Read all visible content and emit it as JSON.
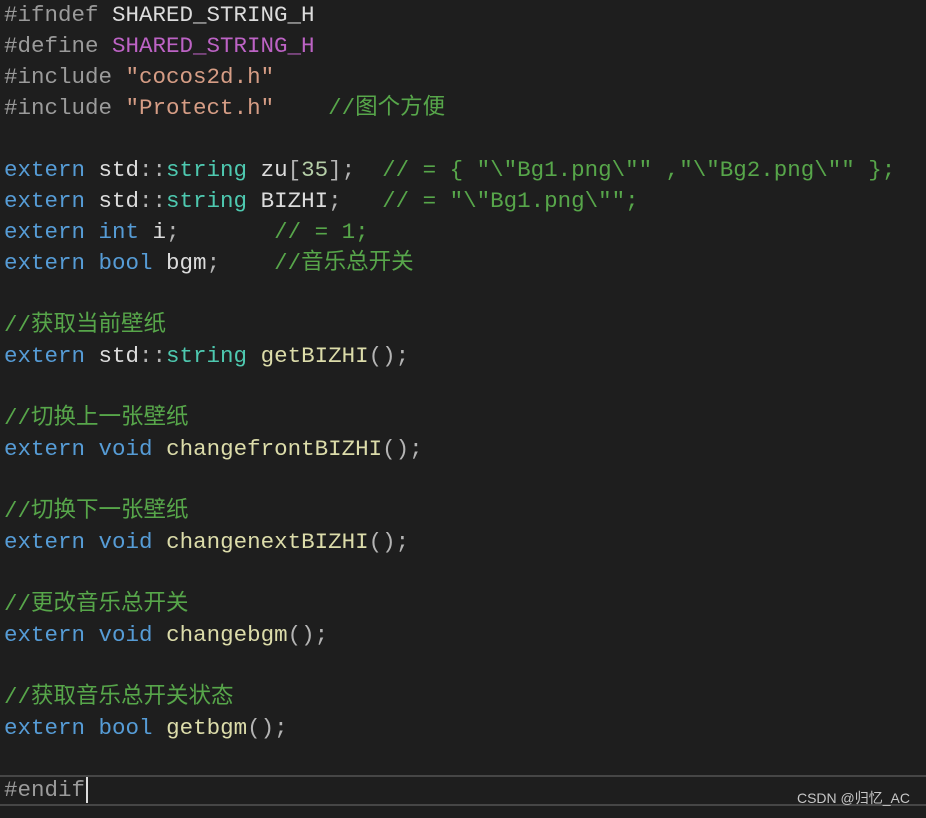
{
  "editor": {
    "lines": [
      [
        {
          "t": "#ifndef",
          "c": "prep"
        },
        {
          "t": " ",
          "c": "ident"
        },
        {
          "t": "SHARED_STRING_H",
          "c": "macro-plain"
        }
      ],
      [
        {
          "t": "#define",
          "c": "prep"
        },
        {
          "t": " ",
          "c": "ident"
        },
        {
          "t": "SHARED_STRING_H",
          "c": "macro"
        }
      ],
      [
        {
          "t": "#include",
          "c": "prep"
        },
        {
          "t": " ",
          "c": "ident"
        },
        {
          "t": "\"cocos2d.h\"",
          "c": "str"
        }
      ],
      [
        {
          "t": "#include",
          "c": "prep"
        },
        {
          "t": " ",
          "c": "ident"
        },
        {
          "t": "\"Protect.h\"",
          "c": "str"
        },
        {
          "t": "    ",
          "c": "ident"
        },
        {
          "t": "//图个方便",
          "c": "com"
        }
      ],
      [],
      [
        {
          "t": "extern",
          "c": "kw"
        },
        {
          "t": " std",
          "c": "ns"
        },
        {
          "t": "::",
          "c": "punc"
        },
        {
          "t": "string",
          "c": "type"
        },
        {
          "t": " zu",
          "c": "ident"
        },
        {
          "t": "[",
          "c": "punc"
        },
        {
          "t": "35",
          "c": "num"
        },
        {
          "t": "];",
          "c": "punc"
        },
        {
          "t": "  ",
          "c": "ident"
        },
        {
          "t": "// = { \"\\\"Bg1.png\\\"\" ,\"\\\"Bg2.png\\\"\" };",
          "c": "com"
        }
      ],
      [
        {
          "t": "extern",
          "c": "kw"
        },
        {
          "t": " std",
          "c": "ns"
        },
        {
          "t": "::",
          "c": "punc"
        },
        {
          "t": "string",
          "c": "type"
        },
        {
          "t": " BIZHI",
          "c": "ident"
        },
        {
          "t": ";",
          "c": "punc"
        },
        {
          "t": "   ",
          "c": "ident"
        },
        {
          "t": "// = \"\\\"Bg1.png\\\"\";",
          "c": "com"
        }
      ],
      [
        {
          "t": "extern",
          "c": "kw"
        },
        {
          "t": " ",
          "c": "ident"
        },
        {
          "t": "int",
          "c": "kw"
        },
        {
          "t": " i",
          "c": "ident"
        },
        {
          "t": ";",
          "c": "punc"
        },
        {
          "t": "       ",
          "c": "ident"
        },
        {
          "t": "// = 1;",
          "c": "com"
        }
      ],
      [
        {
          "t": "extern",
          "c": "kw"
        },
        {
          "t": " ",
          "c": "ident"
        },
        {
          "t": "bool",
          "c": "kw"
        },
        {
          "t": " bgm",
          "c": "ident"
        },
        {
          "t": ";",
          "c": "punc"
        },
        {
          "t": "    ",
          "c": "ident"
        },
        {
          "t": "//音乐总开关",
          "c": "com"
        }
      ],
      [],
      [
        {
          "t": "//获取当前壁纸",
          "c": "com"
        }
      ],
      [
        {
          "t": "extern",
          "c": "kw"
        },
        {
          "t": " std",
          "c": "ns"
        },
        {
          "t": "::",
          "c": "punc"
        },
        {
          "t": "string",
          "c": "type"
        },
        {
          "t": " ",
          "c": "ident"
        },
        {
          "t": "getBIZHI",
          "c": "fn"
        },
        {
          "t": "();",
          "c": "punc"
        }
      ],
      [],
      [
        {
          "t": "//切换上一张壁纸",
          "c": "com"
        }
      ],
      [
        {
          "t": "extern",
          "c": "kw"
        },
        {
          "t": " ",
          "c": "ident"
        },
        {
          "t": "void",
          "c": "kw"
        },
        {
          "t": " ",
          "c": "ident"
        },
        {
          "t": "changefrontBIZHI",
          "c": "fn"
        },
        {
          "t": "();",
          "c": "punc"
        }
      ],
      [],
      [
        {
          "t": "//切换下一张壁纸",
          "c": "com"
        }
      ],
      [
        {
          "t": "extern",
          "c": "kw"
        },
        {
          "t": " ",
          "c": "ident"
        },
        {
          "t": "void",
          "c": "kw"
        },
        {
          "t": " ",
          "c": "ident"
        },
        {
          "t": "changenextBIZHI",
          "c": "fn"
        },
        {
          "t": "();",
          "c": "punc"
        }
      ],
      [],
      [
        {
          "t": "//更改音乐总开关",
          "c": "com"
        }
      ],
      [
        {
          "t": "extern",
          "c": "kw"
        },
        {
          "t": " ",
          "c": "ident"
        },
        {
          "t": "void",
          "c": "kw"
        },
        {
          "t": " ",
          "c": "ident"
        },
        {
          "t": "changebgm",
          "c": "fn"
        },
        {
          "t": "();",
          "c": "punc"
        }
      ],
      [],
      [
        {
          "t": "//获取音乐总开关状态",
          "c": "com"
        }
      ],
      [
        {
          "t": "extern",
          "c": "kw"
        },
        {
          "t": " ",
          "c": "ident"
        },
        {
          "t": "bool",
          "c": "kw"
        },
        {
          "t": " ",
          "c": "ident"
        },
        {
          "t": "getbgm",
          "c": "fn"
        },
        {
          "t": "();",
          "c": "punc"
        }
      ],
      [],
      [
        {
          "t": "#endif",
          "c": "prep"
        }
      ]
    ],
    "current_line": 25
  },
  "watermark": "CSDN @归忆_AC",
  "colors": {
    "background": "#1e1e1e",
    "keyword": "#569cd6",
    "type": "#4ec9b0",
    "function": "#dcdcaa",
    "comment": "#57a64a",
    "string": "#d69d85",
    "preprocessor": "#9b9b9b",
    "macro": "#bd63c5",
    "number": "#b5cea8",
    "identifier": "#dcdcdc"
  }
}
